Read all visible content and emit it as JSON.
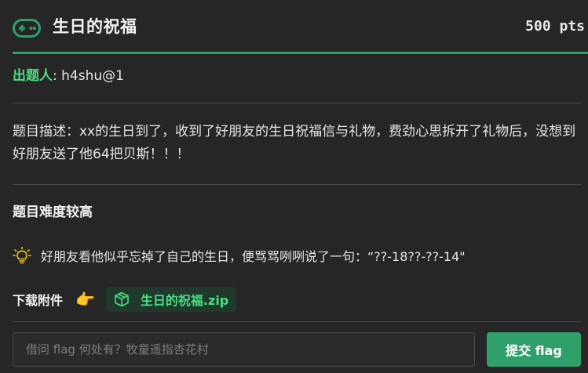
{
  "challenge": {
    "icon": "gamepad-icon",
    "title": "生日的祝福",
    "points": "500 pts"
  },
  "author": {
    "label": "出题人",
    "separator": ":",
    "name": "h4shu@1"
  },
  "description": "题目描述：xx的生日到了，收到了好朋友的生日祝福信与礼物，费劲心思拆开了礼物后，没想到好朋友送了他64把贝斯！！！",
  "difficulty": "题目难度较高",
  "hint": {
    "icon": "lightbulb-icon",
    "text": "好朋友看他似乎忘掉了自己的生日，便骂骂咧咧说了一句：“??-18??-??-14\""
  },
  "attachments": {
    "label": "下载附件",
    "pointer_icon": "pointing-hand-icon",
    "pointer_glyph": "👉",
    "file_icon": "package-icon",
    "file_name": "生日的祝福.zip"
  },
  "flag_form": {
    "placeholder": "借问 flag 何处有？牧童遥指杏花村",
    "value": "",
    "submit_label": "提交 flag"
  },
  "colors": {
    "accent": "#2fa06a",
    "accent_text": "#4ade80",
    "background": "#262626"
  }
}
